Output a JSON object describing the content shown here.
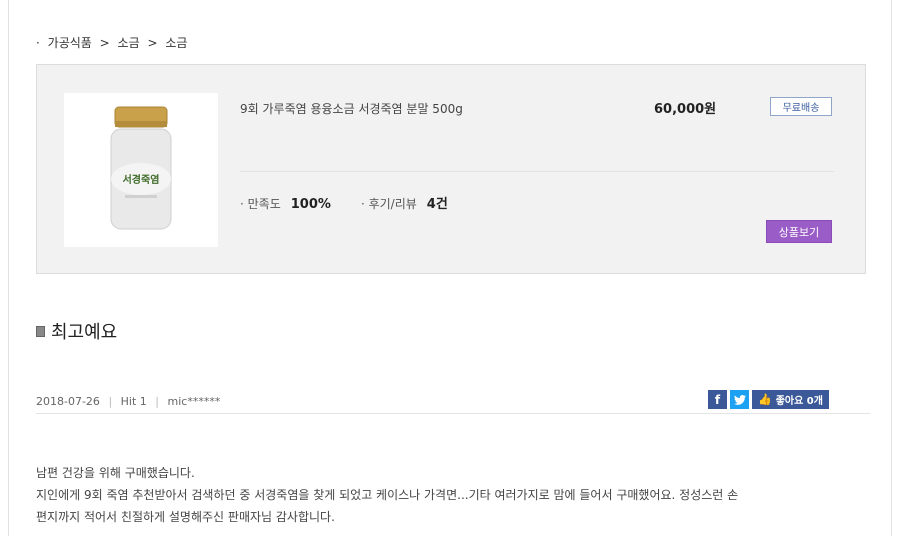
{
  "breadcrumb": {
    "bullet": "·",
    "items": [
      "가공식품",
      "소금",
      "소금"
    ],
    "separator": ">"
  },
  "product": {
    "name": "9회 가루죽염 용융소금 서경죽염 분말 500g",
    "price": "60,000원",
    "shipping_badge": "무료배송",
    "image_label": "서경죽염",
    "stats": [
      {
        "label": "만족도",
        "value": "100%"
      },
      {
        "label": "후기/리뷰",
        "value": "4건"
      }
    ],
    "view_button": "상품보기"
  },
  "review": {
    "title": "최고예요",
    "date": "2018-07-26",
    "hit": "Hit 1",
    "author": "mic******",
    "like_label": "좋아요 0개",
    "body": [
      "남편 건강을 위해 구매했습니다.",
      "지인에게 9회 죽염 추천받아서 검색하던 중 서경죽염을 찾게 되었고 케이스나 가격면...기타 여러가지로 맘에 들어서 구매했어요. 정성스런 손",
      "편지까지 적어서 친절하게 설명해주신 판매자님 감사합니다."
    ]
  },
  "colors": {
    "accent_purple": "#9a5cc6",
    "facebook": "#3b5998",
    "twitter": "#1da1f2"
  },
  "icons": {
    "facebook": "facebook-icon",
    "twitter": "twitter-icon",
    "like": "thumbs-up-icon"
  }
}
